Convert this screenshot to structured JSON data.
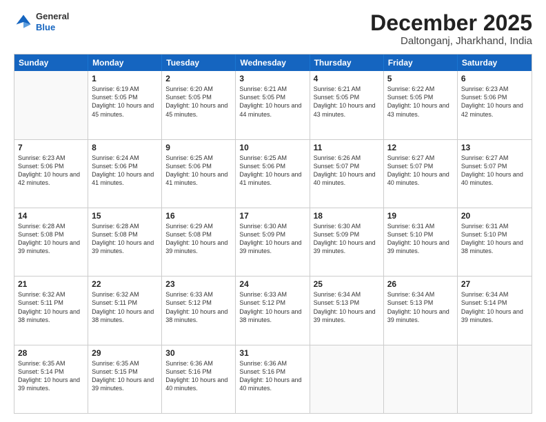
{
  "header": {
    "logo_line1": "General",
    "logo_line2": "Blue",
    "month_title": "December 2025",
    "location": "Daltonganj, Jharkhand, India"
  },
  "days_of_week": [
    "Sunday",
    "Monday",
    "Tuesday",
    "Wednesday",
    "Thursday",
    "Friday",
    "Saturday"
  ],
  "weeks": [
    [
      {
        "day": "",
        "empty": true
      },
      {
        "day": "1",
        "sunrise": "6:19 AM",
        "sunset": "5:05 PM",
        "daylight": "10 hours and 45 minutes."
      },
      {
        "day": "2",
        "sunrise": "6:20 AM",
        "sunset": "5:05 PM",
        "daylight": "10 hours and 45 minutes."
      },
      {
        "day": "3",
        "sunrise": "6:21 AM",
        "sunset": "5:05 PM",
        "daylight": "10 hours and 44 minutes."
      },
      {
        "day": "4",
        "sunrise": "6:21 AM",
        "sunset": "5:05 PM",
        "daylight": "10 hours and 43 minutes."
      },
      {
        "day": "5",
        "sunrise": "6:22 AM",
        "sunset": "5:05 PM",
        "daylight": "10 hours and 43 minutes."
      },
      {
        "day": "6",
        "sunrise": "6:23 AM",
        "sunset": "5:06 PM",
        "daylight": "10 hours and 42 minutes."
      }
    ],
    [
      {
        "day": "7",
        "sunrise": "6:23 AM",
        "sunset": "5:06 PM",
        "daylight": "10 hours and 42 minutes."
      },
      {
        "day": "8",
        "sunrise": "6:24 AM",
        "sunset": "5:06 PM",
        "daylight": "10 hours and 41 minutes."
      },
      {
        "day": "9",
        "sunrise": "6:25 AM",
        "sunset": "5:06 PM",
        "daylight": "10 hours and 41 minutes."
      },
      {
        "day": "10",
        "sunrise": "6:25 AM",
        "sunset": "5:06 PM",
        "daylight": "10 hours and 41 minutes."
      },
      {
        "day": "11",
        "sunrise": "6:26 AM",
        "sunset": "5:07 PM",
        "daylight": "10 hours and 40 minutes."
      },
      {
        "day": "12",
        "sunrise": "6:27 AM",
        "sunset": "5:07 PM",
        "daylight": "10 hours and 40 minutes."
      },
      {
        "day": "13",
        "sunrise": "6:27 AM",
        "sunset": "5:07 PM",
        "daylight": "10 hours and 40 minutes."
      }
    ],
    [
      {
        "day": "14",
        "sunrise": "6:28 AM",
        "sunset": "5:08 PM",
        "daylight": "10 hours and 39 minutes."
      },
      {
        "day": "15",
        "sunrise": "6:28 AM",
        "sunset": "5:08 PM",
        "daylight": "10 hours and 39 minutes."
      },
      {
        "day": "16",
        "sunrise": "6:29 AM",
        "sunset": "5:08 PM",
        "daylight": "10 hours and 39 minutes."
      },
      {
        "day": "17",
        "sunrise": "6:30 AM",
        "sunset": "5:09 PM",
        "daylight": "10 hours and 39 minutes."
      },
      {
        "day": "18",
        "sunrise": "6:30 AM",
        "sunset": "5:09 PM",
        "daylight": "10 hours and 39 minutes."
      },
      {
        "day": "19",
        "sunrise": "6:31 AM",
        "sunset": "5:10 PM",
        "daylight": "10 hours and 39 minutes."
      },
      {
        "day": "20",
        "sunrise": "6:31 AM",
        "sunset": "5:10 PM",
        "daylight": "10 hours and 38 minutes."
      }
    ],
    [
      {
        "day": "21",
        "sunrise": "6:32 AM",
        "sunset": "5:11 PM",
        "daylight": "10 hours and 38 minutes."
      },
      {
        "day": "22",
        "sunrise": "6:32 AM",
        "sunset": "5:11 PM",
        "daylight": "10 hours and 38 minutes."
      },
      {
        "day": "23",
        "sunrise": "6:33 AM",
        "sunset": "5:12 PM",
        "daylight": "10 hours and 38 minutes."
      },
      {
        "day": "24",
        "sunrise": "6:33 AM",
        "sunset": "5:12 PM",
        "daylight": "10 hours and 38 minutes."
      },
      {
        "day": "25",
        "sunrise": "6:34 AM",
        "sunset": "5:13 PM",
        "daylight": "10 hours and 39 minutes."
      },
      {
        "day": "26",
        "sunrise": "6:34 AM",
        "sunset": "5:13 PM",
        "daylight": "10 hours and 39 minutes."
      },
      {
        "day": "27",
        "sunrise": "6:34 AM",
        "sunset": "5:14 PM",
        "daylight": "10 hours and 39 minutes."
      }
    ],
    [
      {
        "day": "28",
        "sunrise": "6:35 AM",
        "sunset": "5:14 PM",
        "daylight": "10 hours and 39 minutes."
      },
      {
        "day": "29",
        "sunrise": "6:35 AM",
        "sunset": "5:15 PM",
        "daylight": "10 hours and 39 minutes."
      },
      {
        "day": "30",
        "sunrise": "6:36 AM",
        "sunset": "5:16 PM",
        "daylight": "10 hours and 40 minutes."
      },
      {
        "day": "31",
        "sunrise": "6:36 AM",
        "sunset": "5:16 PM",
        "daylight": "10 hours and 40 minutes."
      },
      {
        "day": "",
        "empty": true
      },
      {
        "day": "",
        "empty": true
      },
      {
        "day": "",
        "empty": true
      }
    ]
  ]
}
